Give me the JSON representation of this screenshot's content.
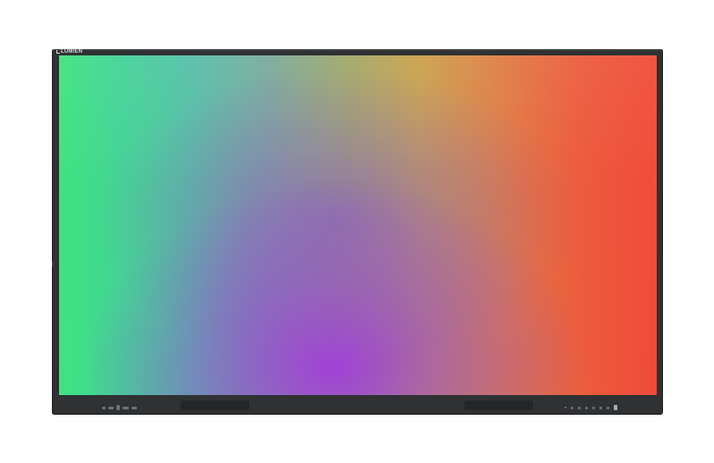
{
  "device": {
    "brand": "LUMIEN",
    "bezel_color": "#2f3133"
  },
  "screen": {
    "gradient_colors": [
      "#3ee57f",
      "#56bfa8",
      "#a1a86a",
      "#df7d45",
      "#ef4b38"
    ],
    "center_color": "#a03cdc"
  },
  "controls": {
    "front_buttons": [
      "button",
      "button",
      "button",
      "button",
      "button",
      "button",
      "button"
    ],
    "power": "power-button"
  }
}
